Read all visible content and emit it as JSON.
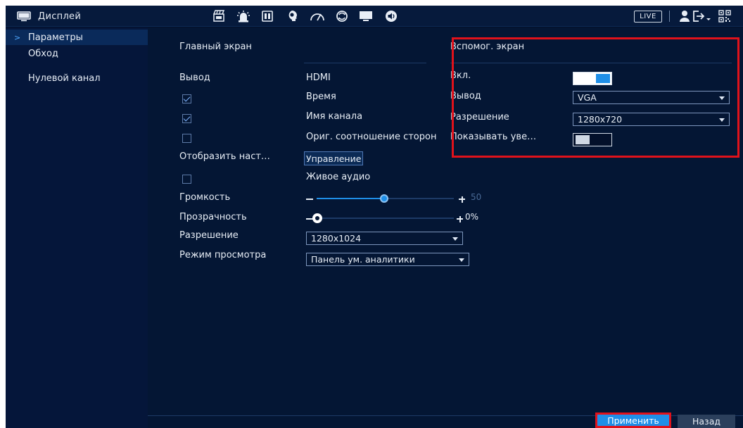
{
  "app": {
    "title": "Дисплей",
    "live_label": "LIVE"
  },
  "sidebar": {
    "items": [
      {
        "label": "Параметры",
        "active": true
      },
      {
        "label": "Обход",
        "active": false
      },
      {
        "label": "Нулевой канал",
        "active": false
      }
    ]
  },
  "main_screen": {
    "section_title": "Главный экран",
    "output_label": "Вывод",
    "output_value": "HDMI",
    "time_label": "Время",
    "time_checked": true,
    "channel_name_label": "Имя канала",
    "channel_name_checked": true,
    "aspect_label": "Ориг. соотношение сторон",
    "aspect_checked": false,
    "display_settings_label": "Отобразить наст…",
    "manage_button": "Управление",
    "live_audio_label": "Живое аудио",
    "live_audio_checked": false,
    "volume_label": "Громкость",
    "volume_value": "50",
    "volume_fraction": 0.5,
    "transparency_label": "Прозрачность",
    "transparency_value": "0%",
    "transparency_fraction": 0.0,
    "resolution_label": "Разрешение",
    "resolution_value": "1280x1024",
    "view_mode_label": "Режим просмотра",
    "view_mode_value": "Панель ум. аналитики"
  },
  "aux_screen": {
    "section_title": "Вспомог. экран",
    "enable_label": "Вкл.",
    "enable_on": true,
    "output_label": "Вывод",
    "output_value": "VGA",
    "resolution_label": "Разрешение",
    "resolution_value": "1280x720",
    "show_label": "Показывать уве…",
    "show_on": false
  },
  "footer": {
    "apply_button": "Применить",
    "back_button": "Назад"
  },
  "icons": [
    "monitor-icon",
    "clapperboard-icon",
    "alarm-light-icon",
    "storage-icon",
    "face-icon",
    "gauge-icon",
    "sync-icon",
    "display-icon",
    "speaker-icon",
    "user-icon",
    "logout-icon",
    "qr-code-icon"
  ],
  "colors": {
    "accent_blue": "#1f8fe8",
    "highlight_red": "#e0121b",
    "background": "#041634"
  }
}
